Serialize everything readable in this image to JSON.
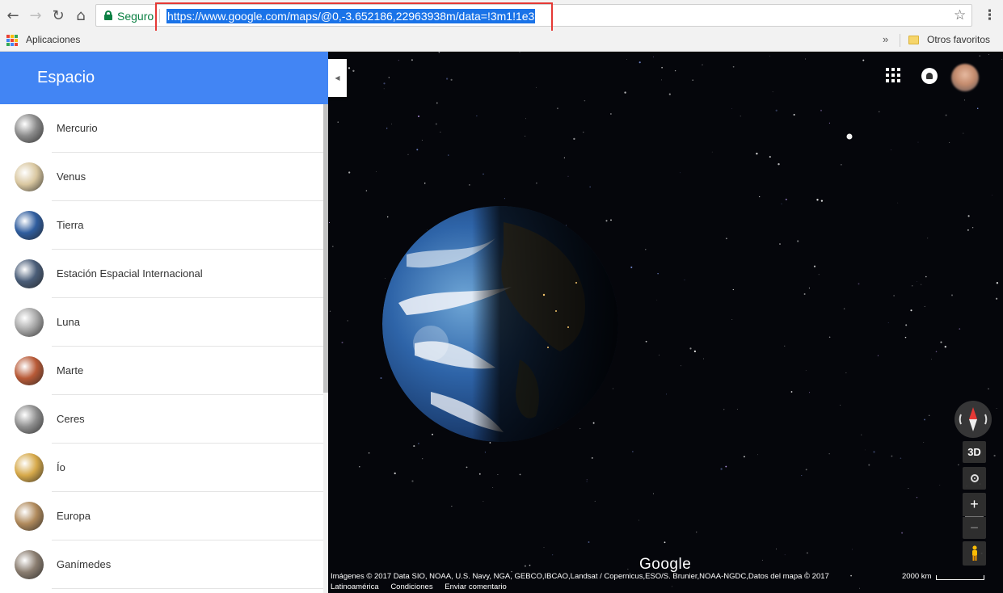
{
  "browser": {
    "secure_label": "Seguro",
    "url": "https://www.google.com/maps/@0,-3.652186,22963938m/data=!3m1!1e3",
    "icons": [
      "back-icon",
      "forward-icon",
      "reload-icon",
      "home-icon",
      "lock-icon",
      "star-icon",
      "menu-icon"
    ]
  },
  "bookmarks": {
    "apps_label": "Aplicaciones",
    "overflow_label": "»",
    "other_label": "Otros favoritos"
  },
  "sidebar": {
    "title": "Espacio",
    "items": [
      {
        "label": "Mercurio",
        "color": "#8a8a8a"
      },
      {
        "label": "Venus",
        "color": "#d9c7a0"
      },
      {
        "label": "Tierra",
        "color": "#2f5d9e"
      },
      {
        "label": "Estación Espacial Internacional",
        "color": "#4a5d78"
      },
      {
        "label": "Luna",
        "color": "#a8a8a8"
      },
      {
        "label": "Marte",
        "color": "#b85a37"
      },
      {
        "label": "Ceres",
        "color": "#8e8e8e"
      },
      {
        "label": "Ío",
        "color": "#d6a94a"
      },
      {
        "label": "Europa",
        "color": "#b08a5c"
      },
      {
        "label": "Ganímedes",
        "color": "#8a7d70"
      }
    ]
  },
  "map": {
    "controls": {
      "three_d_label": "3D",
      "zoom_in_label": "+",
      "zoom_out_label": "−"
    },
    "logo_text": "Google",
    "attribution": "Imágenes © 2017 Data SIO, NOAA, U.S. Navy, NGA, GEBCO,IBCAO,Landsat / Copernicus,ESO/S. Brunier,NOAA-NGDC,Datos del mapa © 2017",
    "footer_links": [
      "Latinoamérica",
      "Condiciones",
      "Enviar comentario"
    ],
    "scale_label": "2000 km"
  },
  "colors": {
    "accent": "#4285f4",
    "url_highlight_border": "#e53935",
    "secure_green": "#0b8043",
    "space_background": "#05060b"
  }
}
